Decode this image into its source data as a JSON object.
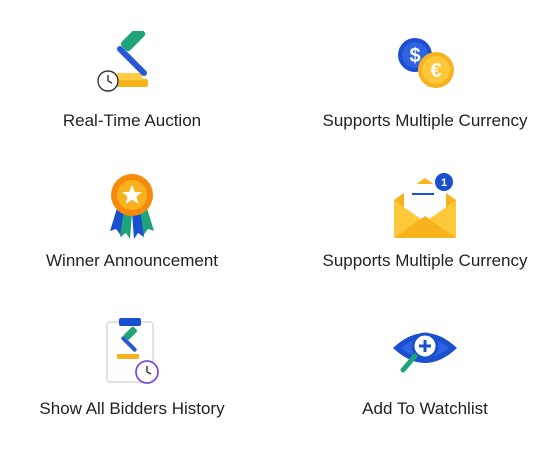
{
  "features": [
    {
      "label": "Real-Time Auction",
      "icon": "auction-gavel-clock-icon"
    },
    {
      "label": "Supports Multiple Currency",
      "icon": "currency-coins-icon"
    },
    {
      "label": "Winner Announcement",
      "icon": "award-ribbon-icon"
    },
    {
      "label": "Supports Multiple Currency",
      "icon": "mail-notification-icon",
      "badge": "1"
    },
    {
      "label": "Show All Bidders History",
      "icon": "bid-history-clipboard-icon"
    },
    {
      "label": "Add To Watchlist",
      "icon": "eye-magnifier-icon"
    }
  ],
  "colors": {
    "text": "#222222",
    "blue": "#1a4fd0",
    "gold": "#f7b21e",
    "orange": "#f58a0b",
    "green": "#1fa37a"
  }
}
